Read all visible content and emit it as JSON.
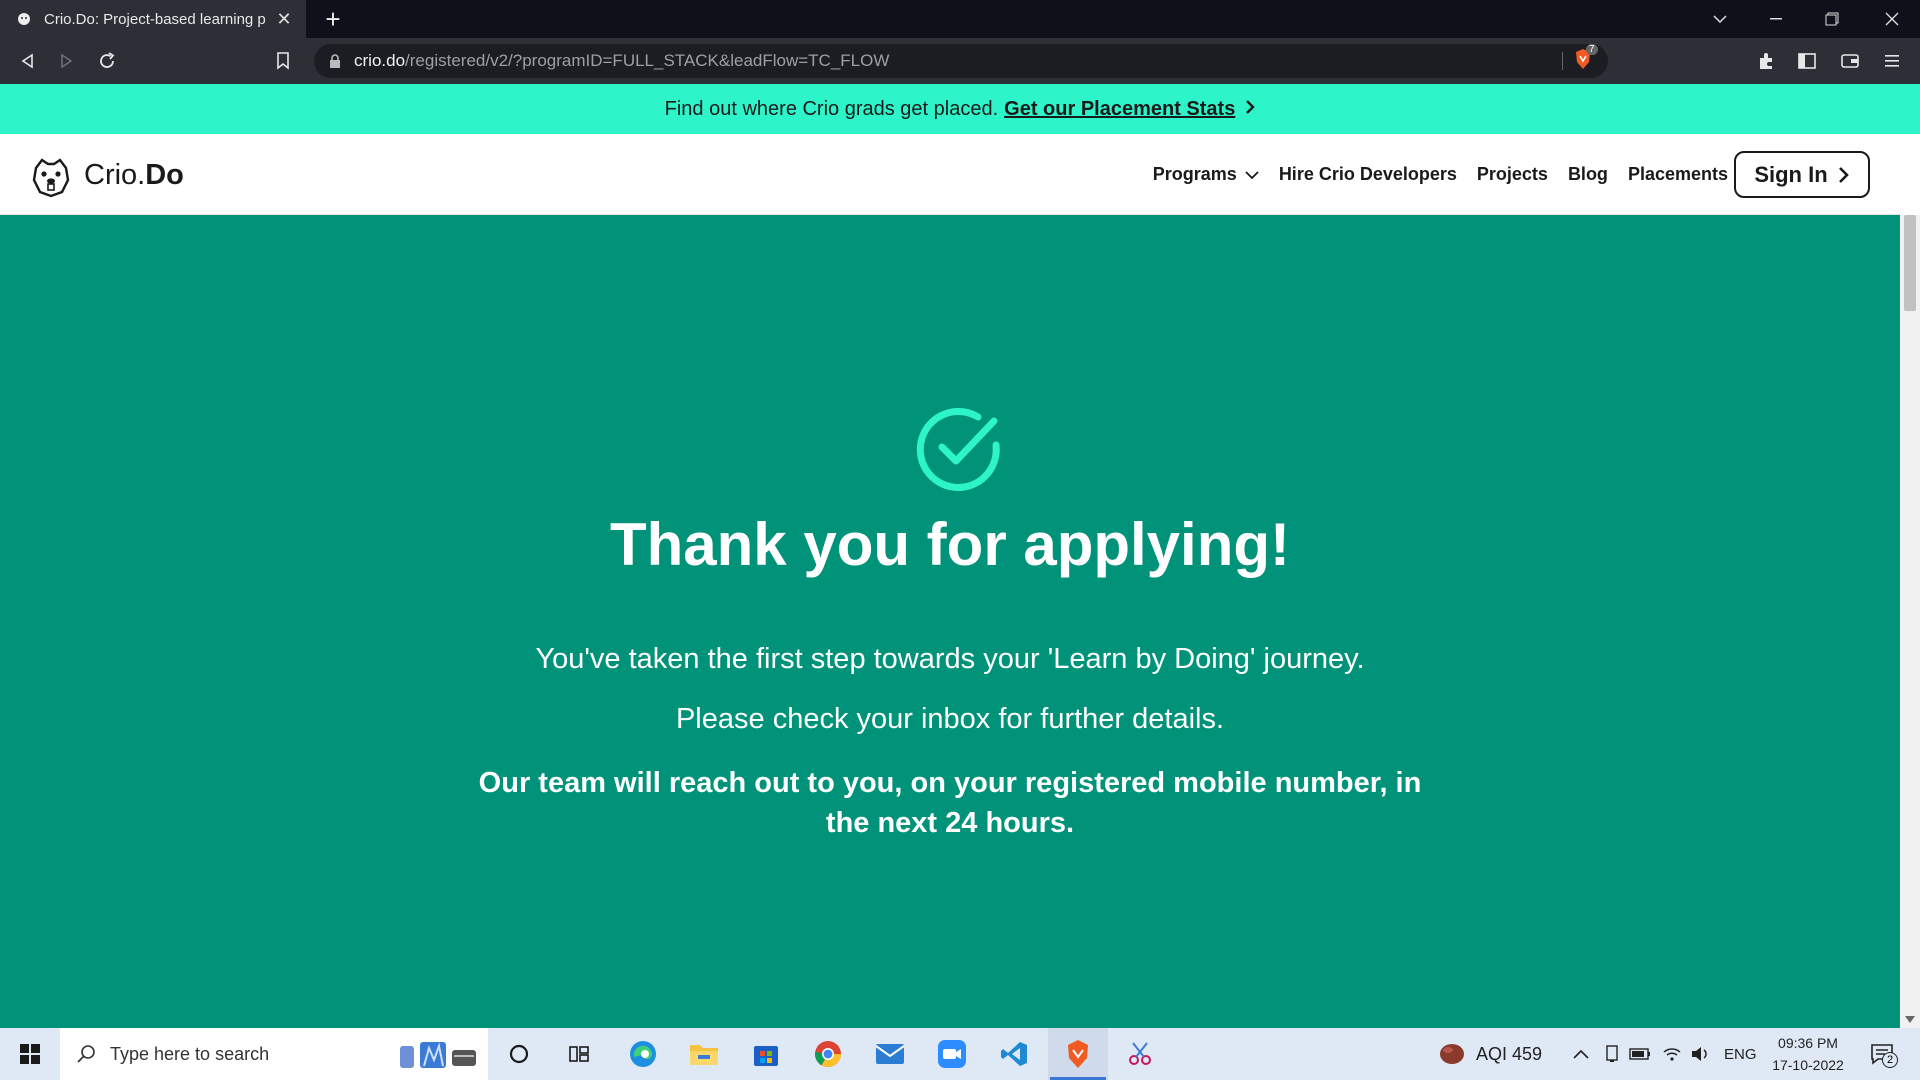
{
  "browser": {
    "tab_title": "Crio.Do: Project-based learning p",
    "url_host": "crio.do",
    "url_path": "/registered/v2/?programID=FULL_STACK&leadFlow=TC_FLOW",
    "shield_count": "7"
  },
  "banner": {
    "text": "Find out where Crio grads get placed.",
    "link": "Get our Placement Stats"
  },
  "sitenav": {
    "logo_light": "Crio.",
    "logo_bold": "Do",
    "links": [
      "Programs",
      "Hire Crio Developers",
      "Projects",
      "Blog",
      "Placements"
    ],
    "signin": "Sign In"
  },
  "hero": {
    "title": "Thank you for applying!",
    "line1": "You've taken the first step towards your 'Learn by Doing' journey.",
    "line2": "Please check your inbox for further details.",
    "line3": "Our team will reach out to you, on your registered mobile number, in the next 24 hours."
  },
  "taskbar": {
    "search_placeholder": "Type here to search",
    "aqi": "AQI 459",
    "lang": "ENG",
    "time": "09:36 PM",
    "date": "17-10-2022",
    "notifications": "2"
  },
  "colors": {
    "banner": "#2ef5c9",
    "hero": "#00937a",
    "check": "#2ef5c9"
  }
}
